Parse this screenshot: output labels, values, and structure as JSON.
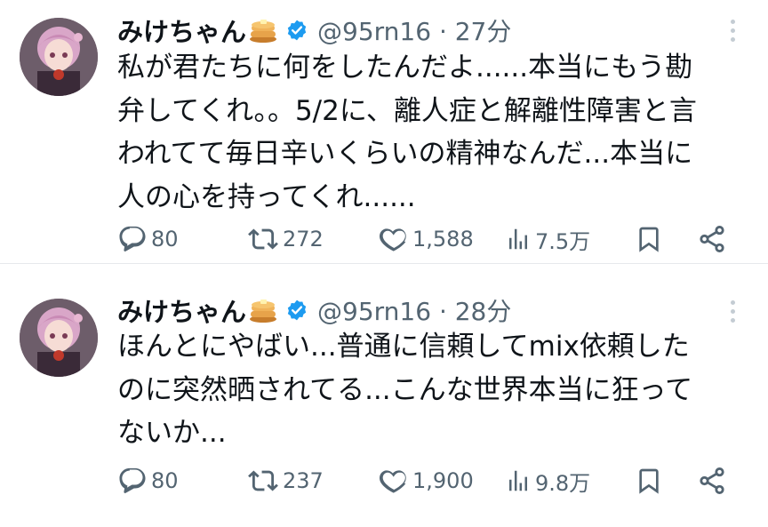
{
  "colors": {
    "text": "#0f1419",
    "secondary": "#536471",
    "verified": "#1d9bf0",
    "divider": "#e6e9ec"
  },
  "tweets": [
    {
      "author_name": "みけちゃん",
      "handle": "@95rn16 · 27分",
      "lines": [
        "私が君たちに何をしたんだよ......本当にもう勘",
        "弁してくれ。。5/2に、離人症と解離性障害と言",
        "われてて毎日辛いくらいの精神なんだ...本当に",
        "人の心を持ってくれ......"
      ],
      "replies": "80",
      "retweets": "272",
      "likes": "1,588",
      "views": "7.5万"
    },
    {
      "author_name": "みけちゃん",
      "handle": "@95rn16 · 28分",
      "lines": [
        "ほんとにやばい...普通に信頼してmix依頼した",
        "のに突然晒されてる...こんな世界本当に狂って",
        "ないか..."
      ],
      "replies": "80",
      "retweets": "237",
      "likes": "1,900",
      "views": "9.8万"
    }
  ],
  "icons": [
    "reply-icon",
    "retweet-icon",
    "like-icon",
    "views-icon",
    "bookmark-icon",
    "share-icon",
    "verified-badge-icon",
    "pancake-emoji-icon",
    "more-options-icon"
  ]
}
